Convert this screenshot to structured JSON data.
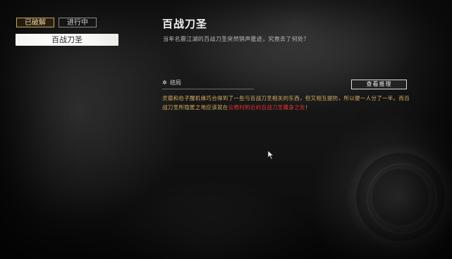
{
  "tabs": {
    "solved": "已破解",
    "ongoing": "进行中"
  },
  "list": {
    "items": [
      "百战刀圣"
    ]
  },
  "detail": {
    "title": "百战刀圣",
    "description": "当年名震江湖的百战刀圣突然销声匿迹，究竟去了何处？",
    "section_icon": "✲",
    "section_label": "结局",
    "view_button": "查看推理",
    "result_text_1": "灵德和伯子醒机缘巧合得到了一些与百战刀圣相关的东西，但又相互提防，所以便一人分了一半。而百战刀圣所隐匿之地应该就在",
    "result_text_red": "云栖村附近的百战刀圣藏身之处",
    "result_text_end": "！"
  },
  "icons": {
    "cursor": "arrow-cursor-icon",
    "section": "asterisk-icon"
  },
  "colors": {
    "accent_gold": "#d8b060",
    "highlight_red": "#e8332f",
    "tab_active_border": "#c9a35a"
  }
}
